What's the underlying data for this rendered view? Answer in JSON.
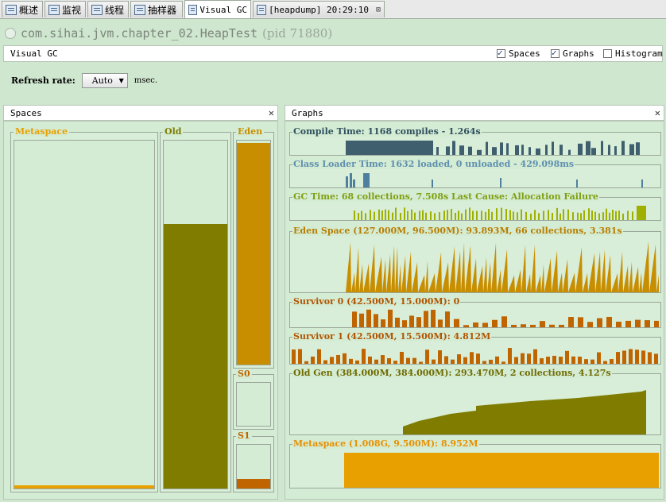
{
  "tabs": [
    {
      "label": "概述"
    },
    {
      "label": "监视"
    },
    {
      "label": "线程"
    },
    {
      "label": "抽样器"
    },
    {
      "label": "Visual GC"
    },
    {
      "label": "[heapdump] 20:29:10"
    }
  ],
  "app": {
    "process": "com.sihai.jvm.chapter_02.HeapTest",
    "pid": "(pid 71880)"
  },
  "header": {
    "title": "Visual GC",
    "checkboxes": [
      {
        "label": "Spaces",
        "checked": true
      },
      {
        "label": "Graphs",
        "checked": true
      },
      {
        "label": "Histogram",
        "checked": false
      }
    ]
  },
  "refresh": {
    "label": "Refresh rate:",
    "value": "Auto",
    "unit": "msec."
  },
  "spaces_panel": {
    "title": "Spaces",
    "spaces": [
      {
        "name": "Metaspace",
        "fill_fraction": 0.01,
        "color": "#e8a000",
        "label_color": "#e8a000"
      },
      {
        "name": "Old",
        "fill_fraction": 0.76,
        "color": "#7f7c00",
        "label_color": "#7f7c00"
      },
      {
        "name": "Eden",
        "fill_fraction": 0.99,
        "color": "#c88e00",
        "label_color": "#c88e00"
      },
      {
        "name": "S0",
        "fill_fraction": 0.0,
        "color": "#c06400",
        "label_color": "#c06400"
      },
      {
        "name": "S1",
        "fill_fraction": 0.22,
        "color": "#c06400",
        "label_color": "#c06400"
      }
    ]
  },
  "graphs_panel": {
    "title": "Graphs",
    "graphs": [
      {
        "key": "compile",
        "label": "Compile Time: 1168 compiles - 1.264s",
        "color": "#3f5f6f",
        "label_color": "#2f4f5f"
      },
      {
        "key": "classloader",
        "label": "Class Loader Time: 1632 loaded, 0 unloaded - 429.098ms",
        "color": "#4f7f9f",
        "label_color": "#5f8faf"
      },
      {
        "key": "gc",
        "label": "GC Time: 68 collections, 7.508s  Last Cause: Allocation Failure",
        "color": "#9fb000",
        "label_color": "#7f9f10"
      },
      {
        "key": "eden",
        "label": "Eden Space (127.000M, 96.500M): 93.893M, 66 collections, 3.381s",
        "color": "#c88e00",
        "label_color": "#b87e00"
      },
      {
        "key": "s0",
        "label": "Survivor 0 (42.500M, 15.000M): 0",
        "color": "#c06400",
        "label_color": "#b05400"
      },
      {
        "key": "s1",
        "label": "Survivor 1 (42.500M, 15.500M): 4.812M",
        "color": "#c06400",
        "label_color": "#b05400"
      },
      {
        "key": "old",
        "label": "Old Gen (384.000M, 384.000M): 293.470M, 2 collections, 4.127s",
        "color": "#7f7c00",
        "label_color": "#6f6c00"
      },
      {
        "key": "meta",
        "label": "Metaspace (1.008G, 9.500M): 8.952M",
        "color": "#e8a000",
        "label_color": "#e89000"
      }
    ]
  }
}
